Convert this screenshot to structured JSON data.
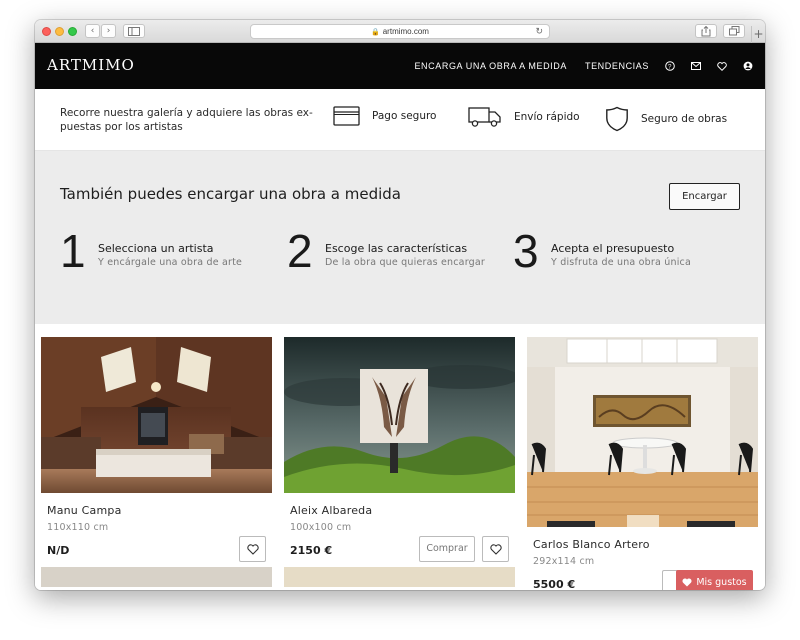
{
  "browser": {
    "url": "artmimo.com",
    "back_label": "‹",
    "forward_label": "›"
  },
  "site": {
    "logo": "ARTMIMO",
    "nav": {
      "commission": "ENCARGA UNA OBRA A MEDIDA",
      "trends": "TENDENCIAS"
    }
  },
  "features": {
    "intro": "Recorre nuestra galería y adquiere las obras ex-puestas por los artistas",
    "items": [
      {
        "icon": "credit-card-icon",
        "label": "Pago seguro"
      },
      {
        "icon": "truck-icon",
        "label": "Envío rápido"
      },
      {
        "icon": "shield-icon",
        "label": "Seguro de obras"
      }
    ]
  },
  "commission": {
    "title": "También puedes encargar una obra a medida",
    "button": "Encargar",
    "steps": [
      {
        "num": "1",
        "title": "Selecciona un artista",
        "subtitle": "Y encárgale una obra de arte"
      },
      {
        "num": "2",
        "title": "Escoge las características",
        "subtitle": "De la obra que quieras encargar"
      },
      {
        "num": "3",
        "title": "Acepta el presupuesto",
        "subtitle": "Y disfruta de una obra única"
      }
    ]
  },
  "artworks": [
    {
      "artist": "Manu Campa",
      "size": "110x110 cm",
      "price": "N/D",
      "buy_label": ""
    },
    {
      "artist": "Aleix Albareda",
      "size": "100x100 cm",
      "price": "2150 €",
      "buy_label": "Comprar"
    },
    {
      "artist": "Carlos Blanco Artero",
      "size": "292x114 cm",
      "price": "5500 €",
      "buy_label": ""
    }
  ],
  "favorites_button": "Mis gustos",
  "colors": {
    "nav_bg": "#080808",
    "commission_bg": "#ececec",
    "favorites_accent": "#d95f60"
  }
}
